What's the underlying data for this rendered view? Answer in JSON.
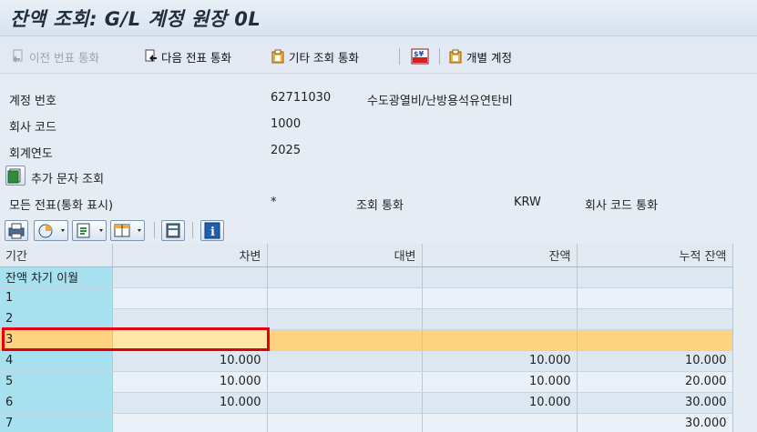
{
  "window": {
    "title": "잔액 조회: G/L 계정 원장 0L"
  },
  "toolbar": {
    "prev_doc_currency": "이전 번표 통화",
    "next_doc_currency": "다음 전표 통화",
    "other_display_currency": "기타 조회 통화",
    "individual_account": "개별 계정"
  },
  "header": {
    "account_label": "계정 번호",
    "account_value": "62711030",
    "account_desc": "수도광열비/난방용석유연탄비",
    "company_label": "회사 코드",
    "company_value": "1000",
    "year_label": "회계연도",
    "year_value": "2025",
    "more_docs_label": "추가 문자 조회",
    "all_docs_label": "모든 전표(통화 표시)",
    "all_docs_value": "*",
    "display_currency_label": "조회 통화",
    "display_currency_value": "KRW",
    "company_currency_label": "회사 코드 통화"
  },
  "table": {
    "columns": [
      "기간",
      "차변",
      "대변",
      "잔액",
      "누적 잔액"
    ],
    "rows": [
      {
        "period": "잔액 차기 이월",
        "debit": "",
        "credit": "",
        "balance": "",
        "cumulative": ""
      },
      {
        "period": "1",
        "debit": "",
        "credit": "",
        "balance": "",
        "cumulative": ""
      },
      {
        "period": "2",
        "debit": "",
        "credit": "",
        "balance": "",
        "cumulative": ""
      },
      {
        "period": "3",
        "debit": "",
        "credit": "",
        "balance": "",
        "cumulative": ""
      },
      {
        "period": "4",
        "debit": "10.000",
        "credit": "",
        "balance": "10.000",
        "cumulative": "10.000"
      },
      {
        "period": "5",
        "debit": "10.000",
        "credit": "",
        "balance": "10.000",
        "cumulative": "20.000"
      },
      {
        "period": "6",
        "debit": "10.000",
        "credit": "",
        "balance": "10.000",
        "cumulative": "30.000"
      },
      {
        "period": "7",
        "debit": "",
        "credit": "",
        "balance": "",
        "cumulative": "30.000"
      }
    ]
  },
  "selected_row_index": 3
}
